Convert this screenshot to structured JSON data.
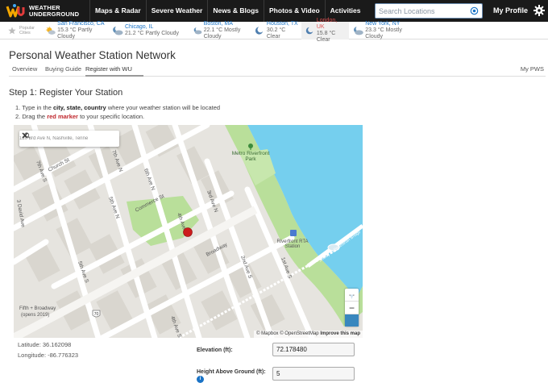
{
  "header": {
    "logo_line1": "WEATHER",
    "logo_line2": "UNDERGROUND",
    "nav": [
      "Maps & Radar",
      "Severe Weather",
      "News & Blogs",
      "Photos & Video",
      "Activities"
    ],
    "search_placeholder": "Search Locations",
    "profile_label": "My Profile"
  },
  "popular": {
    "label_line1": "Popular",
    "label_line2": "Cities",
    "cities": [
      {
        "name": "San Francisco, CA",
        "cond": "15.3 °C Partly Cloudy",
        "icon": "partly-cloudy-icon"
      },
      {
        "name": "Chicago, IL",
        "cond": "21.2 °C Partly Cloudy",
        "icon": "partly-cloudy-night-icon"
      },
      {
        "name": "Boston, MA",
        "cond": "22.1 °C Mostly Cloudy",
        "icon": "mostly-cloudy-night-icon"
      },
      {
        "name": "Houston, TX",
        "cond": "30.2 °C Clear",
        "icon": "clear-night-icon"
      },
      {
        "name": "London, UK",
        "cond": "15.8 °C Clear",
        "icon": "clear-night-icon"
      },
      {
        "name": "New York, NY",
        "cond": "23.3 °C Mostly Cloudy",
        "icon": "mostly-cloudy-night-icon"
      }
    ]
  },
  "page": {
    "title": "Personal Weather Station Network",
    "tabs": [
      "Overview",
      "Buying Guide",
      "Register with WU"
    ],
    "tab_right": "My PWS",
    "active_tab": "Register with WU"
  },
  "register": {
    "step_title": "Step 1: Register Your Station",
    "step1_pre": "1. Type in the",
    "step1_bold": "city, state, country",
    "step1_post": "where your weather station will be located",
    "step2_pre": "2. Drag the",
    "step2_red": "red marker",
    "step2_post": "to your specific location."
  },
  "map": {
    "search_value": "120 3rd Ave N, Nashville, Tenne",
    "attribution_1": "© Mapbox © OpenStreetMap",
    "attribution_2": "Improve this map",
    "streets": {
      "church": "Church St",
      "commerce": "Commerce St",
      "broadway": "Broadway",
      "fifth_n": "5th Ave N",
      "fourth_n": "4th Ave N",
      "third_n": "3rd Ave N",
      "second_n": "2nd Ave N",
      "second_s": "2nd Ave S",
      "third_s": "3rd Ave S",
      "first_s": "1st Ave S",
      "fourth_s": "4th Ave S",
      "fifth_s": "5th Ave S",
      "sixth_n": "6th Ave N",
      "seventh_n": "7th Ave N",
      "seventh_s": "7th Ave S",
      "david_ave": "3 David Ave",
      "shelby": "Shelby St Pedestrian Bridge"
    },
    "pois": {
      "park_1": "Metro Riverfront",
      "park_2": "Park",
      "rta_1": "Riverfront RTA",
      "rta_2": "Station",
      "fifth_broadway_1": "Fifth + Broadway",
      "fifth_broadway_2": "(opens 2019)",
      "route": "70"
    }
  },
  "coords": {
    "latitude_label": "Latitude: 36.162098",
    "longitude_label": "Longitude: -86.776323"
  },
  "fields": {
    "elevation_label": "Elevation (ft):",
    "elevation_value": "72.178480",
    "height_label": "Height Above Ground (ft):",
    "height_value": "5"
  }
}
